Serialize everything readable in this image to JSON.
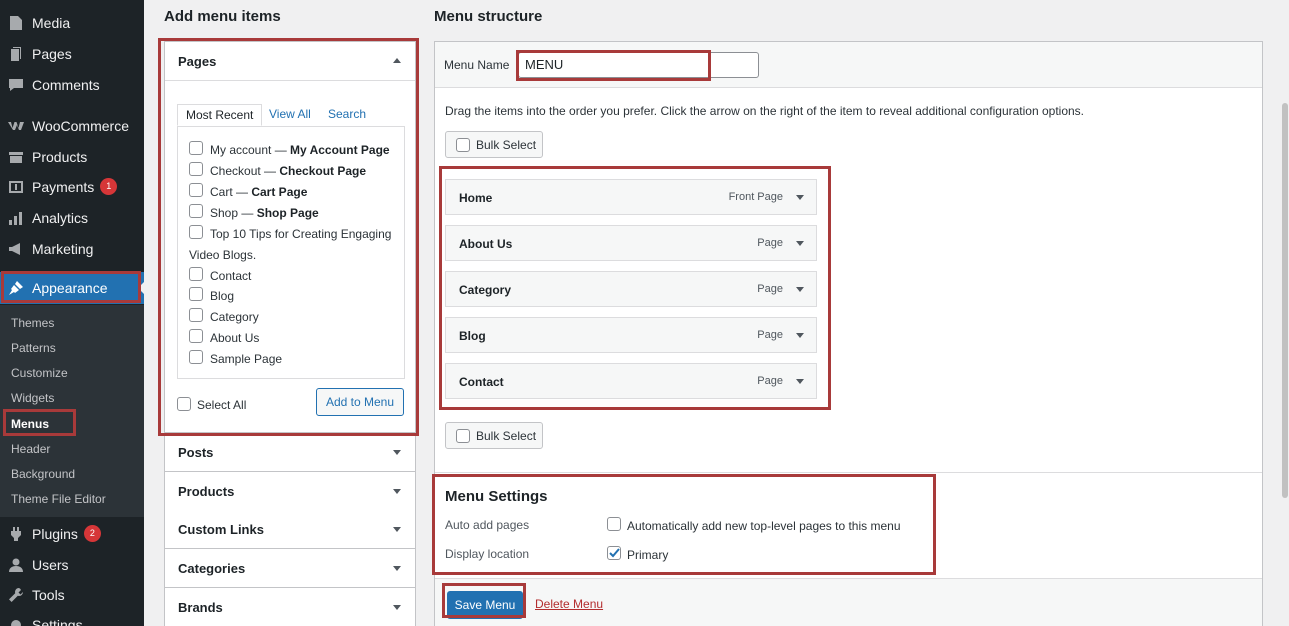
{
  "sidebar": {
    "items": [
      {
        "label": "Media",
        "icon": "media-icon"
      },
      {
        "label": "Pages",
        "icon": "pages-icon"
      },
      {
        "label": "Comments",
        "icon": "comments-icon"
      },
      {
        "label": "WooCommerce",
        "icon": "woocommerce-icon"
      },
      {
        "label": "Products",
        "icon": "products-icon"
      },
      {
        "label": "Payments",
        "icon": "payments-icon",
        "badge": "1"
      },
      {
        "label": "Analytics",
        "icon": "analytics-icon"
      },
      {
        "label": "Marketing",
        "icon": "marketing-icon"
      },
      {
        "label": "Appearance",
        "icon": "appearance-icon"
      },
      {
        "label": "Plugins",
        "icon": "plugins-icon",
        "badge": "2"
      },
      {
        "label": "Users",
        "icon": "users-icon"
      },
      {
        "label": "Tools",
        "icon": "tools-icon"
      },
      {
        "label": "Settings",
        "icon": "settings-icon"
      }
    ],
    "submenu": [
      "Themes",
      "Patterns",
      "Customize",
      "Widgets",
      "Menus",
      "Header",
      "Background",
      "Theme File Editor"
    ]
  },
  "add_items": {
    "heading": "Add menu items",
    "pages": {
      "title": "Pages",
      "tabs": [
        "Most Recent",
        "View All",
        "Search"
      ],
      "list": [
        {
          "text": "My account — ",
          "bold": "My Account Page"
        },
        {
          "text": "Checkout — ",
          "bold": "Checkout Page"
        },
        {
          "text": "Cart — ",
          "bold": "Cart Page"
        },
        {
          "text": "Shop — ",
          "bold": "Shop Page"
        },
        {
          "text": "Top 10 Tips for Creating Engaging",
          "bold": ""
        },
        {
          "text": "Contact",
          "bold": ""
        },
        {
          "text": "Blog",
          "bold": ""
        },
        {
          "text": "Category",
          "bold": ""
        },
        {
          "text": "About Us",
          "bold": ""
        },
        {
          "text": "Sample Page",
          "bold": ""
        }
      ],
      "wrap_line": "Video Blogs.",
      "select_all": "Select All",
      "add_button": "Add to Menu"
    },
    "sections": [
      "Posts",
      "Products",
      "Custom Links",
      "Categories",
      "Brands"
    ]
  },
  "structure": {
    "heading": "Menu structure",
    "name_label": "Menu Name",
    "name_value": "MENU",
    "instructions": "Drag the items into the order you prefer. Click the arrow on the right of the item to reveal additional configuration options.",
    "bulk_select": "Bulk Select",
    "items": [
      {
        "title": "Home",
        "type": "Front Page"
      },
      {
        "title": "About Us",
        "type": "Page"
      },
      {
        "title": "Category",
        "type": "Page"
      },
      {
        "title": "Blog",
        "type": "Page"
      },
      {
        "title": "Contact",
        "type": "Page"
      }
    ],
    "settings": {
      "title": "Menu Settings",
      "auto_add_label": "Auto add pages",
      "auto_add_text": "Automatically add new top-level pages to this menu",
      "auto_add_checked": false,
      "location_label": "Display location",
      "location_text": "Primary",
      "location_checked": true
    },
    "save_button": "Save Menu",
    "delete_link": "Delete Menu"
  },
  "colors": {
    "accent": "#2271b1",
    "highlight": "#a83a3a",
    "sidebar": "#1d2327"
  }
}
